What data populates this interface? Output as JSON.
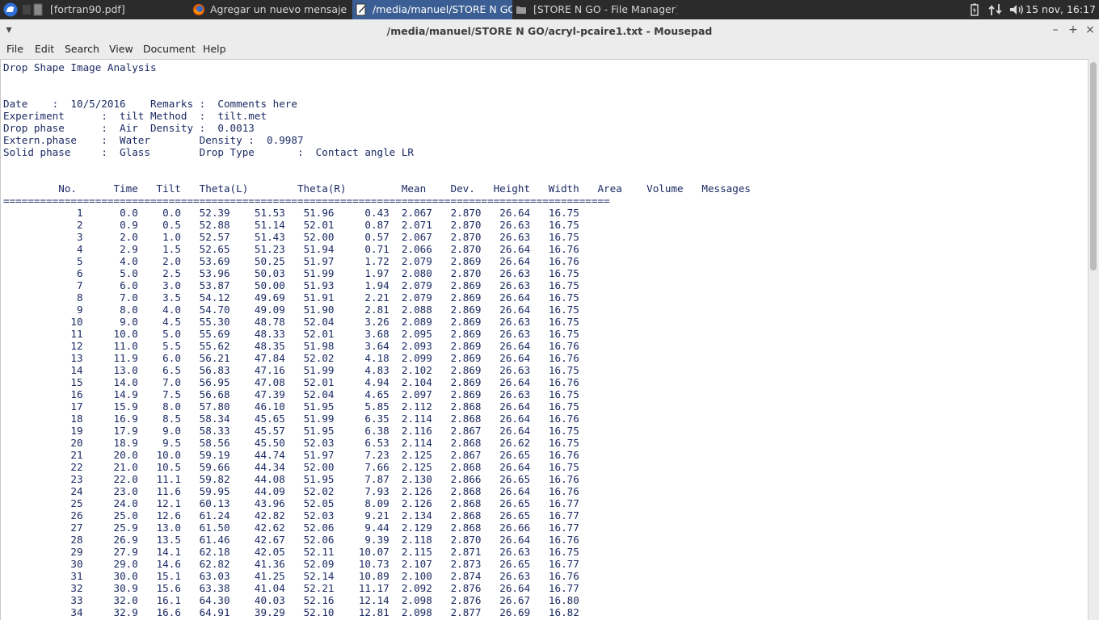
{
  "panel": {
    "tasks": [
      {
        "label": "[fortran90.pdf]",
        "icon": "document-icon"
      },
      {
        "label": "Agregar un nuevo mensaje ...",
        "icon": "firefox-icon"
      },
      {
        "label": "/media/manuel/STORE N GO...",
        "icon": "text-editor-icon"
      },
      {
        "label": "[STORE N GO - File Manager]",
        "icon": "folder-icon"
      }
    ],
    "clock": "15 nov, 16:17"
  },
  "window": {
    "title": "/media/manuel/STORE N GO/acryl-pcaire1.txt - Mousepad"
  },
  "menu": [
    "File",
    "Edit",
    "Search",
    "View",
    "Document",
    "Help"
  ],
  "document": {
    "header": [
      "Drop Shape Image Analysis",
      "",
      "",
      "Date    :  10/5/2016    Remarks :  Comments here",
      "Experiment      :  tilt Method  :  tilt.met",
      "Drop phase      :  Air  Density :  0.0013",
      "Extern.phase    :  Water        Density :  0.9987",
      "Solid phase     :  Glass        Drop Type       :  Contact angle LR",
      "",
      "",
      "         No.      Time   Tilt   Theta(L)        Theta(R)         Mean    Dev.   Height   Width   Area    Volume   Messages",
      "==================================================================================================="
    ],
    "rows": [
      [
        "1",
        "0.0",
        "0.0",
        "52.39",
        "51.53",
        "51.96",
        "0.43",
        "2.067",
        "2.870",
        "26.64",
        "16.75"
      ],
      [
        "2",
        "0.9",
        "0.5",
        "52.88",
        "51.14",
        "52.01",
        "0.87",
        "2.071",
        "2.870",
        "26.63",
        "16.75"
      ],
      [
        "3",
        "2.0",
        "1.0",
        "52.57",
        "51.43",
        "52.00",
        "0.57",
        "2.067",
        "2.870",
        "26.63",
        "16.75"
      ],
      [
        "4",
        "2.9",
        "1.5",
        "52.65",
        "51.23",
        "51.94",
        "0.71",
        "2.066",
        "2.870",
        "26.64",
        "16.76"
      ],
      [
        "5",
        "4.0",
        "2.0",
        "53.69",
        "50.25",
        "51.97",
        "1.72",
        "2.079",
        "2.869",
        "26.64",
        "16.76"
      ],
      [
        "6",
        "5.0",
        "2.5",
        "53.96",
        "50.03",
        "51.99",
        "1.97",
        "2.080",
        "2.870",
        "26.63",
        "16.75"
      ],
      [
        "7",
        "6.0",
        "3.0",
        "53.87",
        "50.00",
        "51.93",
        "1.94",
        "2.079",
        "2.869",
        "26.63",
        "16.75"
      ],
      [
        "8",
        "7.0",
        "3.5",
        "54.12",
        "49.69",
        "51.91",
        "2.21",
        "2.079",
        "2.869",
        "26.64",
        "16.75"
      ],
      [
        "9",
        "8.0",
        "4.0",
        "54.70",
        "49.09",
        "51.90",
        "2.81",
        "2.088",
        "2.869",
        "26.64",
        "16.75"
      ],
      [
        "10",
        "9.0",
        "4.5",
        "55.30",
        "48.78",
        "52.04",
        "3.26",
        "2.089",
        "2.869",
        "26.63",
        "16.75"
      ],
      [
        "11",
        "10.0",
        "5.0",
        "55.69",
        "48.33",
        "52.01",
        "3.68",
        "2.095",
        "2.869",
        "26.63",
        "16.75"
      ],
      [
        "12",
        "11.0",
        "5.5",
        "55.62",
        "48.35",
        "51.98",
        "3.64",
        "2.093",
        "2.869",
        "26.64",
        "16.76"
      ],
      [
        "13",
        "11.9",
        "6.0",
        "56.21",
        "47.84",
        "52.02",
        "4.18",
        "2.099",
        "2.869",
        "26.64",
        "16.76"
      ],
      [
        "14",
        "13.0",
        "6.5",
        "56.83",
        "47.16",
        "51.99",
        "4.83",
        "2.102",
        "2.869",
        "26.63",
        "16.75"
      ],
      [
        "15",
        "14.0",
        "7.0",
        "56.95",
        "47.08",
        "52.01",
        "4.94",
        "2.104",
        "2.869",
        "26.64",
        "16.76"
      ],
      [
        "16",
        "14.9",
        "7.5",
        "56.68",
        "47.39",
        "52.04",
        "4.65",
        "2.097",
        "2.869",
        "26.63",
        "16.75"
      ],
      [
        "17",
        "15.9",
        "8.0",
        "57.80",
        "46.10",
        "51.95",
        "5.85",
        "2.112",
        "2.868",
        "26.64",
        "16.75"
      ],
      [
        "18",
        "16.9",
        "8.5",
        "58.34",
        "45.65",
        "51.99",
        "6.35",
        "2.114",
        "2.868",
        "26.64",
        "16.76"
      ],
      [
        "19",
        "17.9",
        "9.0",
        "58.33",
        "45.57",
        "51.95",
        "6.38",
        "2.116",
        "2.867",
        "26.64",
        "16.75"
      ],
      [
        "20",
        "18.9",
        "9.5",
        "58.56",
        "45.50",
        "52.03",
        "6.53",
        "2.114",
        "2.868",
        "26.62",
        "16.75"
      ],
      [
        "21",
        "20.0",
        "10.0",
        "59.19",
        "44.74",
        "51.97",
        "7.23",
        "2.125",
        "2.867",
        "26.65",
        "16.76"
      ],
      [
        "22",
        "21.0",
        "10.5",
        "59.66",
        "44.34",
        "52.00",
        "7.66",
        "2.125",
        "2.868",
        "26.64",
        "16.75"
      ],
      [
        "23",
        "22.0",
        "11.1",
        "59.82",
        "44.08",
        "51.95",
        "7.87",
        "2.130",
        "2.866",
        "26.65",
        "16.76"
      ],
      [
        "24",
        "23.0",
        "11.6",
        "59.95",
        "44.09",
        "52.02",
        "7.93",
        "2.126",
        "2.868",
        "26.64",
        "16.76"
      ],
      [
        "25",
        "24.0",
        "12.1",
        "60.13",
        "43.96",
        "52.05",
        "8.09",
        "2.126",
        "2.868",
        "26.65",
        "16.77"
      ],
      [
        "26",
        "25.0",
        "12.6",
        "61.24",
        "42.82",
        "52.03",
        "9.21",
        "2.134",
        "2.868",
        "26.65",
        "16.77"
      ],
      [
        "27",
        "25.9",
        "13.0",
        "61.50",
        "42.62",
        "52.06",
        "9.44",
        "2.129",
        "2.868",
        "26.66",
        "16.77"
      ],
      [
        "28",
        "26.9",
        "13.5",
        "61.46",
        "42.67",
        "52.06",
        "9.39",
        "2.118",
        "2.870",
        "26.64",
        "16.76"
      ],
      [
        "29",
        "27.9",
        "14.1",
        "62.18",
        "42.05",
        "52.11",
        "10.07",
        "2.115",
        "2.871",
        "26.63",
        "16.75"
      ],
      [
        "30",
        "29.0",
        "14.6",
        "62.82",
        "41.36",
        "52.09",
        "10.73",
        "2.107",
        "2.873",
        "26.65",
        "16.77"
      ],
      [
        "31",
        "30.0",
        "15.1",
        "63.03",
        "41.25",
        "52.14",
        "10.89",
        "2.100",
        "2.874",
        "26.63",
        "16.76"
      ],
      [
        "32",
        "30.9",
        "15.6",
        "63.38",
        "41.04",
        "52.21",
        "11.17",
        "2.092",
        "2.876",
        "26.64",
        "16.77"
      ],
      [
        "33",
        "32.0",
        "16.1",
        "64.30",
        "40.03",
        "52.16",
        "12.14",
        "2.098",
        "2.876",
        "26.67",
        "16.80"
      ],
      [
        "34",
        "32.9",
        "16.6",
        "64.91",
        "39.29",
        "52.10",
        "12.81",
        "2.098",
        "2.877",
        "26.69",
        "16.82"
      ]
    ]
  }
}
